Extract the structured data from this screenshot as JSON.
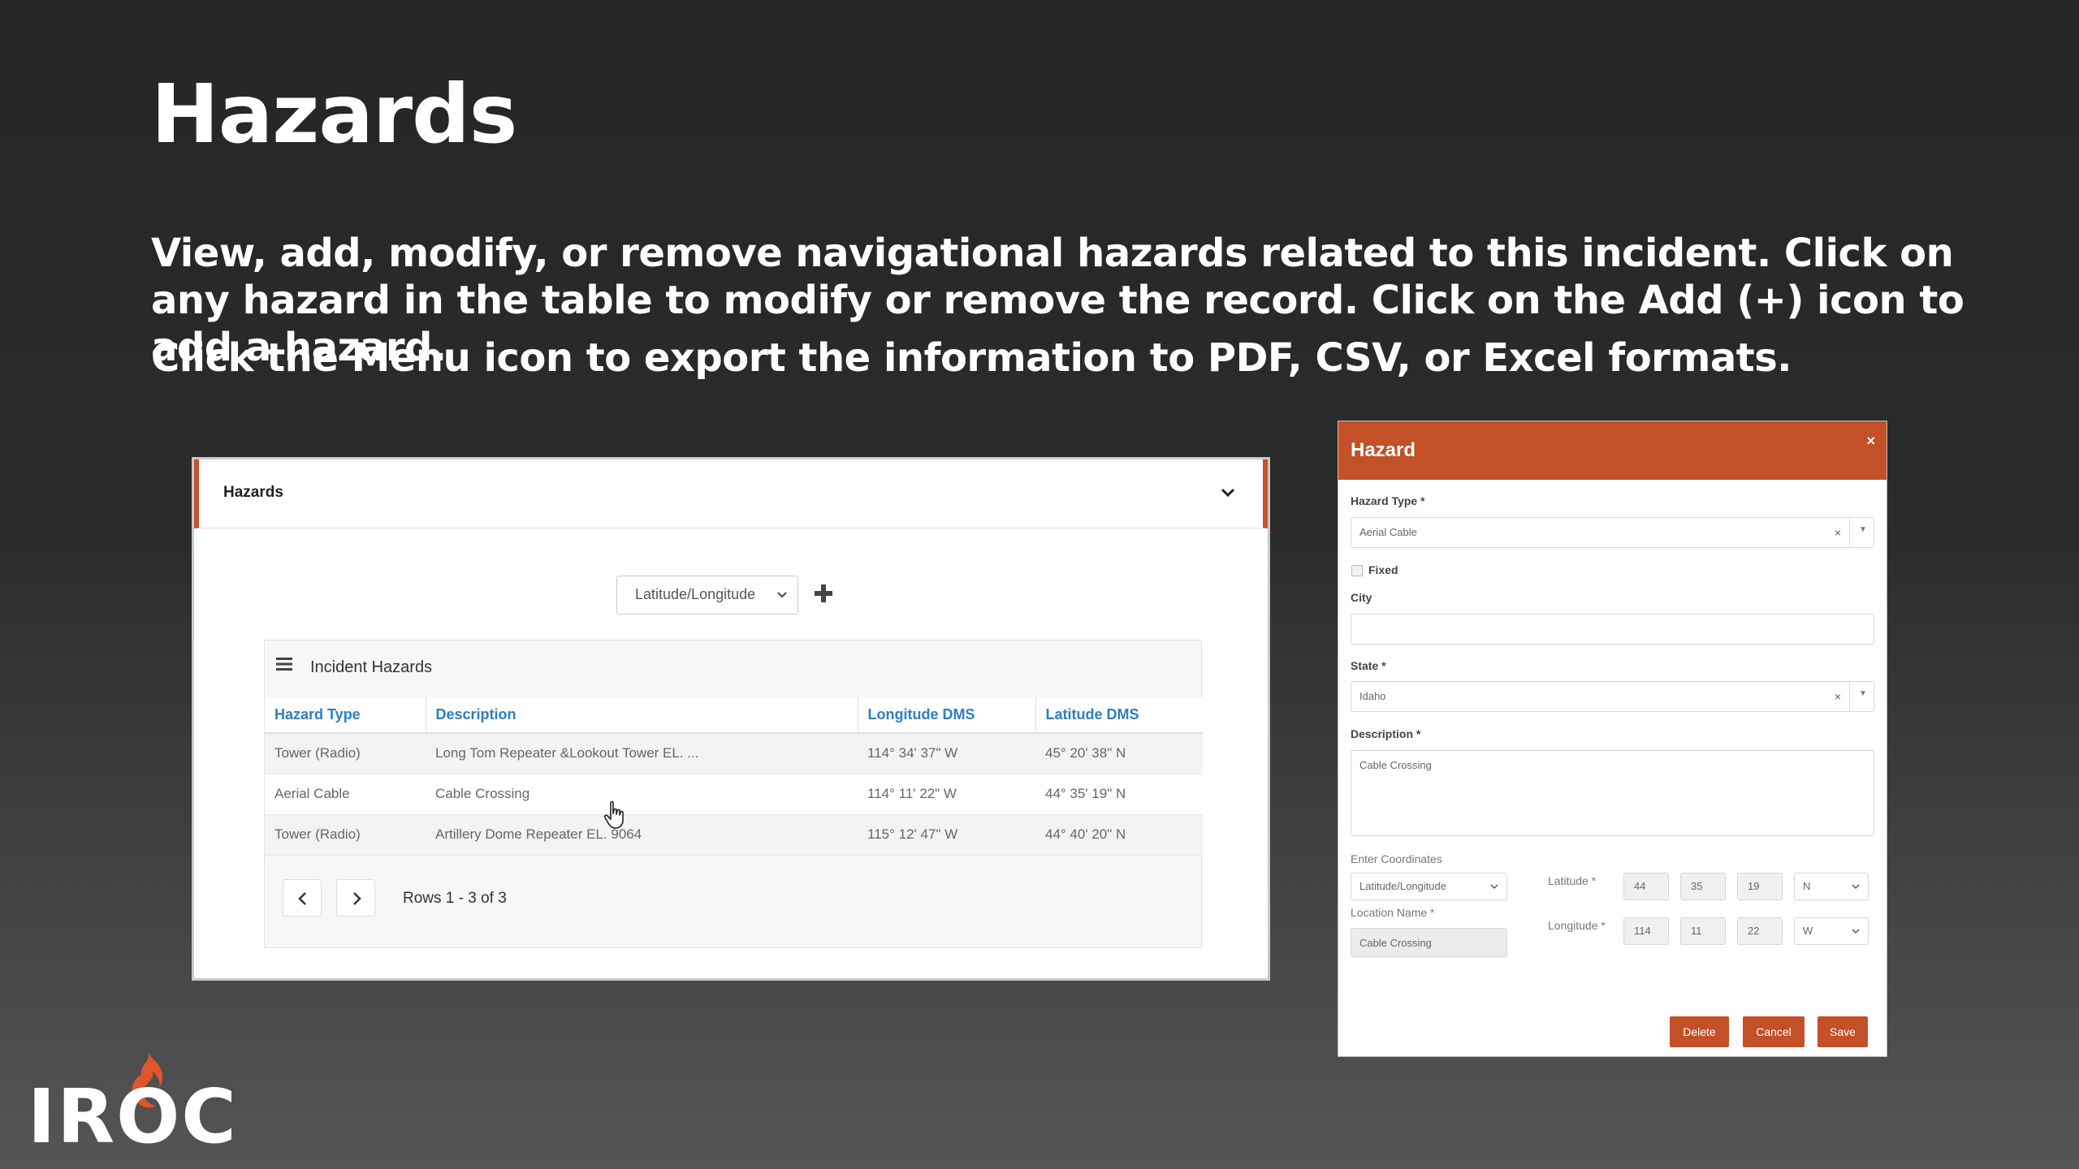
{
  "slide": {
    "title": "Hazards",
    "paragraph1": "View, add, modify, or remove navigational hazards related to this incident. Click on any hazard in the table to modify or remove the record. Click on the Add (+) icon to add a hazard.",
    "paragraph2": "Click the Menu icon to export the information to PDF, CSV, or Excel formats."
  },
  "panel": {
    "title": "Hazards",
    "coord_select": "Latitude/Longitude",
    "table_title": "Incident Hazards",
    "columns": [
      "Hazard Type",
      "Description",
      "Longitude DMS",
      "Latitude DMS"
    ],
    "rows": [
      [
        "Tower (Radio)",
        "Long Tom Repeater &Lookout Tower  EL. ...",
        "114° 34' 37\" W",
        "45° 20' 38\" N"
      ],
      [
        "Aerial Cable",
        "Cable Crossing",
        "114° 11' 22\" W",
        "44° 35' 19\" N"
      ],
      [
        "Tower (Radio)",
        "Artillery Dome Repeater EL. 9064",
        "115° 12' 47\" W",
        "44° 40' 20\" N"
      ]
    ],
    "rows_info": "Rows 1 - 3 of 3"
  },
  "dialog": {
    "title": "Hazard",
    "close": "×",
    "hazard_type_label": "Hazard Type *",
    "hazard_type_value": "Aerial Cable",
    "fixed_label": "Fixed",
    "city_label": "City",
    "city_value": "",
    "state_label": "State *",
    "state_value": "Idaho",
    "description_label": "Description *",
    "description_value": "Cable Crossing",
    "enter_coordinates_label": "Enter Coordinates",
    "coordinates_select": "Latitude/Longitude",
    "location_name_label": "Location Name *",
    "location_name_value": "Cable Crossing",
    "latitude_label": "Latitude *",
    "latitude": {
      "deg": "44",
      "min": "35",
      "sec": "19",
      "dir": "N"
    },
    "longitude_label": "Longitude *",
    "longitude": {
      "deg": "114",
      "min": "11",
      "sec": "22",
      "dir": "W"
    },
    "delete_label": "Delete",
    "cancel_label": "Cancel",
    "save_label": "Save"
  },
  "logo": {
    "text": "IROC"
  },
  "colors": {
    "accent": "#c45028",
    "link": "#2d7fc1",
    "background": "#2a2a2a"
  }
}
